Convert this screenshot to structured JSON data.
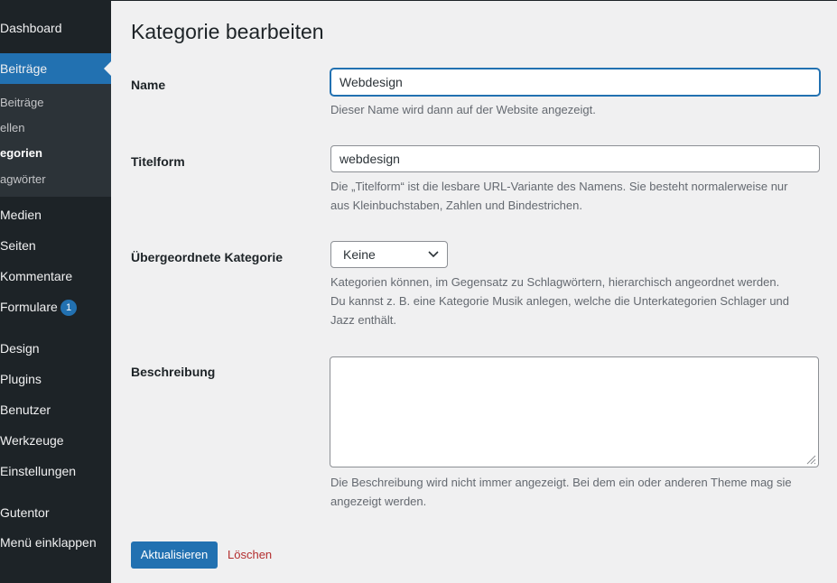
{
  "sidebar": {
    "items": [
      {
        "label": "Dashboard"
      },
      {
        "label": "Beiträge"
      },
      {
        "label": "Medien"
      },
      {
        "label": "Seiten"
      },
      {
        "label": "Kommentare"
      },
      {
        "label": "Formulare",
        "badge": "1"
      },
      {
        "label": "Design"
      },
      {
        "label": "Plugins"
      },
      {
        "label": "Benutzer"
      },
      {
        "label": "Werkzeuge"
      },
      {
        "label": "Einstellungen"
      },
      {
        "label": "Gutentor"
      },
      {
        "label": "Menü einklappen"
      }
    ],
    "submenu": [
      {
        "label": "Beiträge"
      },
      {
        "label": "ellen"
      },
      {
        "label": "egorien"
      },
      {
        "label": "agwörter"
      }
    ]
  },
  "page": {
    "title": "Kategorie bearbeiten"
  },
  "form": {
    "name": {
      "label": "Name",
      "value": "Webdesign",
      "help": "Dieser Name wird dann auf der Website angezeigt."
    },
    "slug": {
      "label": "Titelform",
      "value": "webdesign",
      "help_line1": "Die „Titelform“ ist die lesbare URL-Variante des Namens. Sie besteht normalerweise nur",
      "help_line2": "aus Kleinbuchstaben, Zahlen und Bindestrichen."
    },
    "parent": {
      "label": "Übergeordnete Kategorie",
      "selected": "Keine",
      "help_line1": "Kategorien können, im Gegensatz zu Schlagwörtern, hierarchisch angeordnet werden.",
      "help_line2": "Du kannst z. B. eine Kategorie Musik anlegen, welche die Unterkategorien Schlager und",
      "help_line3": "Jazz enthält."
    },
    "description": {
      "label": "Beschreibung",
      "value": "",
      "help_line1": "Die Beschreibung wird nicht immer angezeigt. Bei dem ein oder anderen Theme mag sie",
      "help_line2": "angezeigt werden."
    },
    "update_label": "Aktualisieren",
    "delete_label": "Löschen"
  },
  "colors": {
    "sidebar_bg": "#1d2327",
    "accent": "#2271b1",
    "delete": "#b32d2e"
  },
  "icons": {
    "dropdown": "chevron-down-icon",
    "resize": "resize-handle-icon"
  }
}
